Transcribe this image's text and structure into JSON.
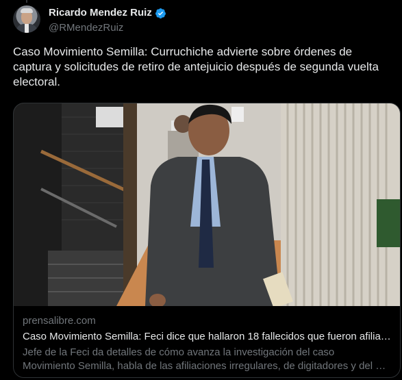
{
  "author": {
    "name": "Ricardo Mendez Ruiz",
    "handle": "@RMendezRuiz",
    "verified": true,
    "verified_color": "#1d9bf0"
  },
  "tweet": {
    "text": "Caso Movimiento Semilla: Curruchiche advierte sobre órdenes de captura y solicitudes de retiro de antejuicio después de segunda vuelta electoral."
  },
  "card": {
    "domain": "prensalibre.com",
    "title": "Caso Movimiento Semilla: Feci dice que hallaron 18 fallecidos que fueron afiliados",
    "description_line1": "Jefe de la Feci da detalles de cómo avanza la investigación del caso",
    "description_line2": "Movimiento Semilla, habla de las afiliaciones irregulares, de digitadores y del …"
  },
  "colors": {
    "background": "#000000",
    "text_primary": "#e7e9ea",
    "text_secondary": "#71767b",
    "border": "#2f3336"
  }
}
